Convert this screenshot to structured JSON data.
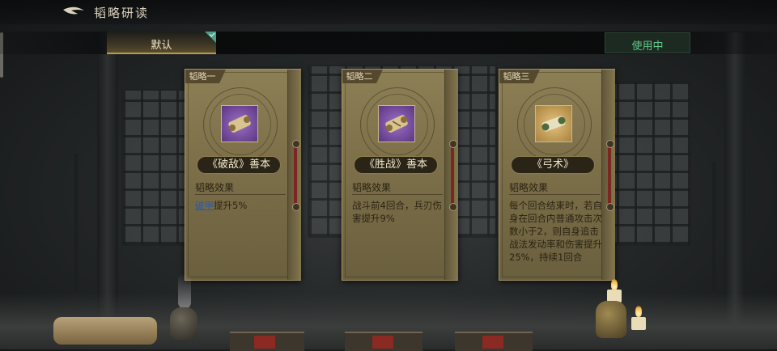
{
  "header": {
    "title": "韬略研读"
  },
  "tabs": {
    "default_label": "默认",
    "in_use_label": "使用中"
  },
  "section_title": "韬略效果",
  "cards": [
    {
      "tag": "韬略一",
      "name": "《破敌》善本",
      "item_color": "purple",
      "effect_keyword": "破甲",
      "effect_rest": "提升5%"
    },
    {
      "tag": "韬略二",
      "name": "《胜战》善本",
      "item_color": "purple",
      "effect": "战斗前4回合，兵刃伤害提升9%"
    },
    {
      "tag": "韬略三",
      "name": "《弓术》",
      "item_color": "gold",
      "effect": "每个回合结束时，若自身在回合内普通攻击次数小于2，则自身追击战法发动率和伤害提升25%，持续1回合"
    }
  ],
  "colors": {
    "accent_gold": "#b79a55",
    "in_use_green": "#63c88a",
    "keyword_blue": "#2c5aa8",
    "card_parchment": "#8d7f55"
  },
  "icons": [
    "back-arrow-icon",
    "check-icon",
    "scroll-icon",
    "candle-icon"
  ]
}
